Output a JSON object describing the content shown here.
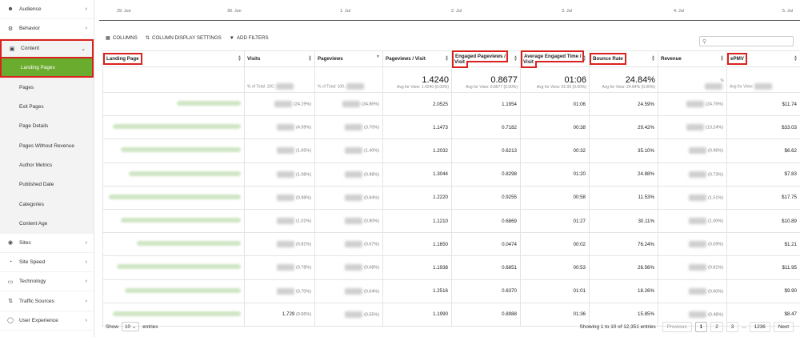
{
  "sidebar": {
    "items": [
      {
        "label": "Audience",
        "icon": "users-icon"
      },
      {
        "label": "Behavior",
        "icon": "behavior-icon"
      },
      {
        "label": "Content",
        "icon": "content-icon"
      }
    ],
    "content_sub": [
      "Landing Pages",
      "Pages",
      "Exit Pages",
      "Page Details",
      "Pages Without Revenue",
      "Author Metrics",
      "Published Date",
      "Categories",
      "Content Age"
    ],
    "bottom_items": [
      {
        "label": "Sites",
        "icon": "globe-icon"
      },
      {
        "label": "Site Speed",
        "icon": "speed-icon"
      },
      {
        "label": "Technology",
        "icon": "monitor-icon"
      },
      {
        "label": "Traffic Sources",
        "icon": "traffic-icon"
      },
      {
        "label": "User Experience",
        "icon": "ux-icon"
      }
    ]
  },
  "timeline": {
    "labels": [
      "29. Jun",
      "30. Jun",
      "1. Jul",
      "2. Jul",
      "3. Jul",
      "4. Jul",
      "5. Jul"
    ]
  },
  "toolbar": {
    "columns": "COLUMNS",
    "display_settings": "COLUMN DISPLAY SETTINGS",
    "add_filters": "ADD FILTERS"
  },
  "table": {
    "headers": [
      "Landing Page",
      "Visits",
      "Pageviews",
      "Pageviews / Visit",
      "Engaged Pageviews / Visit",
      "Average Engaged Time / Visit",
      "Bounce Rate",
      "Revenue",
      "ePMV"
    ],
    "summary": {
      "visits_note": "% of Total: 100.",
      "pageviews_note": "% of Total: 100.",
      "ppv": "1.4240",
      "ppv_note": "Avg for View: 1.4240 (0.00%)",
      "eppv": "0.8677",
      "eppv_note": "Avg for View: 0.8677 (0.00%)",
      "aet": "01:06",
      "aet_note": "Avg for View: 01:06 (0.00%)",
      "bounce": "24.84%",
      "bounce_note": "Avg for View: 24.84% (0.00%)",
      "rev_note": "%",
      "epmv_note": "Avg for View:"
    },
    "rows": [
      {
        "visits": "",
        "visits_pct": "(24.19%)",
        "pv_pct": "(34.86%)",
        "ppv": "2.0525",
        "eppv": "1.1954",
        "aet": "01:06",
        "bounce": "24.59%",
        "rev_pct": "(24.76%)",
        "epmv": "$11.74"
      },
      {
        "visits": "",
        "visits_pct": "(4.59%)",
        "pv_pct": "(3.70%)",
        "ppv": "1.1473",
        "eppv": "0.7182",
        "aet": "00:38",
        "bounce": "29.42%",
        "rev_pct": "(13.24%)",
        "epmv": "$33.03"
      },
      {
        "visits": "",
        "visits_pct": "(1.65%)",
        "pv_pct": "(1.40%)",
        "ppv": "1.2032",
        "eppv": "0.6213",
        "aet": "00:32",
        "bounce": "35.10%",
        "rev_pct": "(0.96%)",
        "epmv": "$6.62"
      },
      {
        "visits": "",
        "visits_pct": "(1.08%)",
        "pv_pct": "(0.98%)",
        "ppv": "1.3044",
        "eppv": "0.8298",
        "aet": "01:20",
        "bounce": "24.88%",
        "rev_pct": "(0.73%)",
        "epmv": "$7.83"
      },
      {
        "visits": "",
        "visits_pct": "(0.98%)",
        "pv_pct": "(0.84%)",
        "ppv": "1.2220",
        "eppv": "0.9255",
        "aet": "00:58",
        "bounce": "11.53%",
        "rev_pct": "(1.51%)",
        "epmv": "$17.75"
      },
      {
        "visits": "",
        "visits_pct": "(1.01%)",
        "pv_pct": "(0.80%)",
        "ppv": "1.1210",
        "eppv": "0.6869",
        "aet": "01:27",
        "bounce": "30.11%",
        "rev_pct": "(1.00%)",
        "epmv": "$10.89"
      },
      {
        "visits": "",
        "visits_pct": "(0.81%)",
        "pv_pct": "(0.67%)",
        "ppv": "1.1650",
        "eppv": "0.0474",
        "aet": "00:02",
        "bounce": "76.24%",
        "rev_pct": "(0.09%)",
        "epmv": "$1.21"
      },
      {
        "visits": "",
        "visits_pct": "(0.78%)",
        "pv_pct": "(0.68%)",
        "ppv": "1.1938",
        "eppv": "0.6851",
        "aet": "00:53",
        "bounce": "26.56%",
        "rev_pct": "(0.81%)",
        "epmv": "$11.95"
      },
      {
        "visits": "",
        "visits_pct": "(0.70%)",
        "pv_pct": "(0.64%)",
        "ppv": "1.2516",
        "eppv": "0.8370",
        "aet": "01:01",
        "bounce": "18.26%",
        "rev_pct": "(0.60%)",
        "epmv": "$9.90"
      },
      {
        "visits": "1,729",
        "visits_pct": "(0.66%)",
        "pv_pct": "(0.55%)",
        "ppv": "1.1990",
        "eppv": "0.8988",
        "aet": "01:36",
        "bounce": "15.85%",
        "rev_pct": "(0.48%)",
        "epmv": "$8.47"
      }
    ]
  },
  "footer": {
    "show": "Show",
    "entries_value": "10",
    "entries": "entries",
    "showing": "Showing 1 to 10 of 12,351 entries",
    "previous": "Previous",
    "pages": [
      "1",
      "2",
      "3",
      "...",
      "1236"
    ],
    "next": "Next"
  },
  "colors": {
    "active_green": "#6aac2e",
    "highlight_red": "#d9221d"
  }
}
